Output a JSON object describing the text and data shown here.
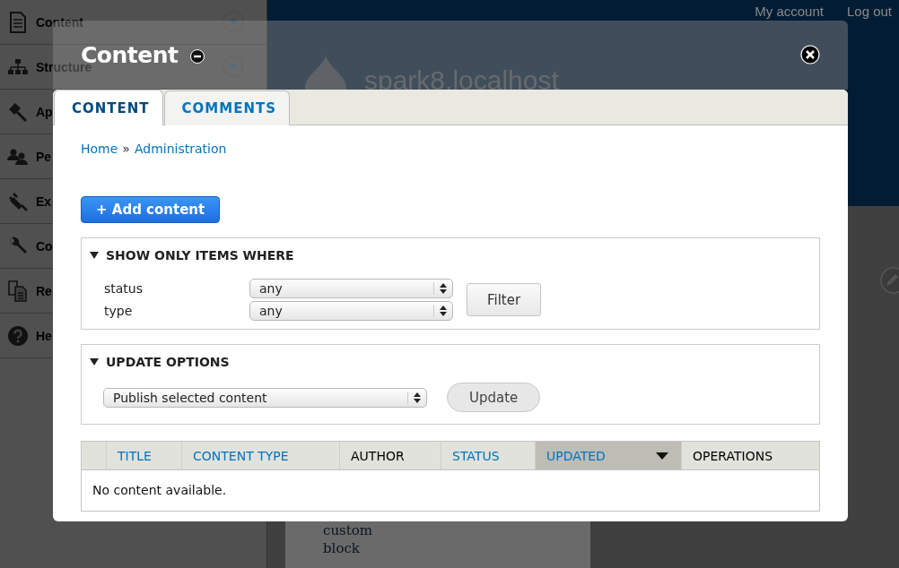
{
  "sidebar": {
    "items": [
      {
        "label": "Content",
        "expandable": true
      },
      {
        "label": "Structure",
        "expandable": true
      },
      {
        "label": "Ap"
      },
      {
        "label": "Pe"
      },
      {
        "label": "Ex"
      },
      {
        "label": "Co"
      },
      {
        "label": "Re"
      },
      {
        "label": "He"
      }
    ]
  },
  "header": {
    "links": [
      "My account",
      "Log out"
    ],
    "site_name": "spark8.localhost"
  },
  "page": {
    "block_label": "custom block"
  },
  "modal": {
    "title": "Content",
    "tabs": [
      {
        "label": "CONTENT",
        "selected": true
      },
      {
        "label": "COMMENTS",
        "selected": false
      }
    ],
    "breadcrumb": {
      "links": [
        "Home",
        "Administration"
      ],
      "separator": "»"
    },
    "add_button": "+ Add content",
    "filters": {
      "legend": "SHOW ONLY ITEMS WHERE",
      "expanded": true,
      "fields": [
        {
          "label": "status",
          "value": "any"
        },
        {
          "label": "type",
          "value": "any"
        }
      ],
      "button": "Filter"
    },
    "update_options": {
      "legend": "UPDATE OPTIONS",
      "expanded": true,
      "value": "Publish selected content",
      "button": "Update"
    },
    "table": {
      "columns": [
        {
          "label": "TITLE",
          "sortable": true,
          "selected": false
        },
        {
          "label": "CONTENT TYPE",
          "sortable": true,
          "selected": false
        },
        {
          "label": "AUTHOR",
          "sortable": false,
          "selected": false
        },
        {
          "label": "STATUS",
          "sortable": true,
          "selected": false
        },
        {
          "label": "UPDATED",
          "sortable": true,
          "selected": true
        },
        {
          "label": "OPERATIONS",
          "sortable": false,
          "selected": false
        }
      ],
      "empty_text": "No content available."
    }
  }
}
